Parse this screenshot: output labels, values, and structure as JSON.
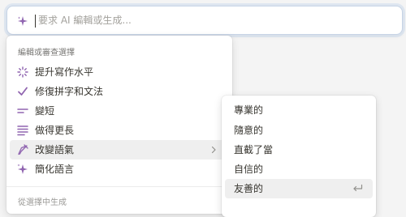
{
  "prompt": {
    "placeholder": "要求 AI 編輯或生成...",
    "value": "",
    "icon": "sparkle-icon",
    "accent": "#9065b0"
  },
  "menu": {
    "header": "編輯或審查選擇",
    "items": [
      {
        "label": "提升寫作水平",
        "icon": "magic-wand-sparkle-icon"
      },
      {
        "label": "修復拼字和文法",
        "icon": "check-icon"
      },
      {
        "label": "變短",
        "icon": "short-text-icon"
      },
      {
        "label": "做得更長",
        "icon": "long-text-icon"
      },
      {
        "label": "改變語氣",
        "icon": "pen-nib-icon",
        "has_submenu": true,
        "active": true
      },
      {
        "label": "簡化語言",
        "icon": "sparkle-icon"
      }
    ],
    "footer": "從選擇中生成"
  },
  "submenu": {
    "items": [
      {
        "label": "專業的"
      },
      {
        "label": "隨意的"
      },
      {
        "label": "直截了當"
      },
      {
        "label": "自信的"
      },
      {
        "label": "友善的",
        "active": true,
        "shortcut_icon": "enter-icon"
      }
    ]
  },
  "colors": {
    "accent_purple": "#9065b0",
    "menu_bg": "#ffffff",
    "hover_bg": "#efefef",
    "text": "#37352f"
  }
}
